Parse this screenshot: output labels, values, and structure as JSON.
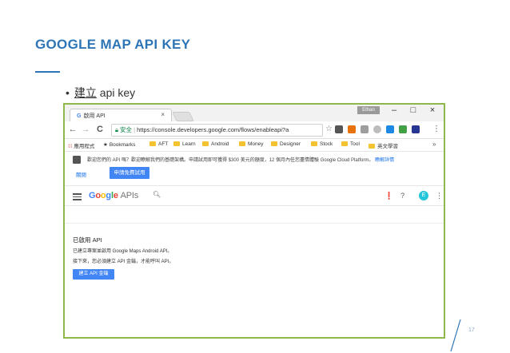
{
  "slide": {
    "title": "GOOGLE MAP API KEY",
    "bullet_prefix": "建立",
    "bullet_rest": " api key",
    "page_number": "17"
  },
  "browser": {
    "tab_title": "啟用 API",
    "tab_close": "×",
    "user_chip": "Ethan",
    "window_minimize": "–",
    "window_maximize": "□",
    "window_close": "×",
    "nav_back": "←",
    "nav_forward": "→",
    "nav_reload": "C",
    "secure_label": "安全",
    "url": "https://console.developers.google.com/flows/enableapi?a",
    "bookmarks": [
      {
        "label": "應用程式",
        "type": "apps"
      },
      {
        "label": "Bookmarks",
        "type": "star"
      },
      {
        "label": "AFT",
        "type": "folder"
      },
      {
        "label": "Learn",
        "type": "folder"
      },
      {
        "label": "Android",
        "type": "folder"
      },
      {
        "label": "Money",
        "type": "folder"
      },
      {
        "label": "Designer",
        "type": "folder"
      },
      {
        "label": "Stock",
        "type": "folder"
      },
      {
        "label": "Tool",
        "type": "folder"
      },
      {
        "label": "英文學習",
        "type": "folder"
      }
    ],
    "bookmarks_more": "»"
  },
  "promo": {
    "text": "歡迎您們的 API 嗎？歡迎瞭解我們的基礎架構。申請試用即可獲得 $300 美元的額度，12 個月內任您盡情體驗 Google Cloud Platform。",
    "link": "瞭解詳情",
    "dismiss": "關閉",
    "trial_button": "申請免費試用"
  },
  "console": {
    "logo_google": "Google",
    "logo_apis": "APIs",
    "enabled_title": "已啟用 API",
    "line1": "已建立專案並啟用 Google Maps Android API。",
    "line2": "接下來，您必須建立 API 金鑰，才能呼叫 API。",
    "create_button": "建立 API 金鑰",
    "avatar_letter": "E"
  },
  "colors": {
    "accent": "#2e75b6",
    "frame_border": "#8fb84a",
    "google_blue": "#4285f4",
    "secure_green": "#0b8043"
  }
}
